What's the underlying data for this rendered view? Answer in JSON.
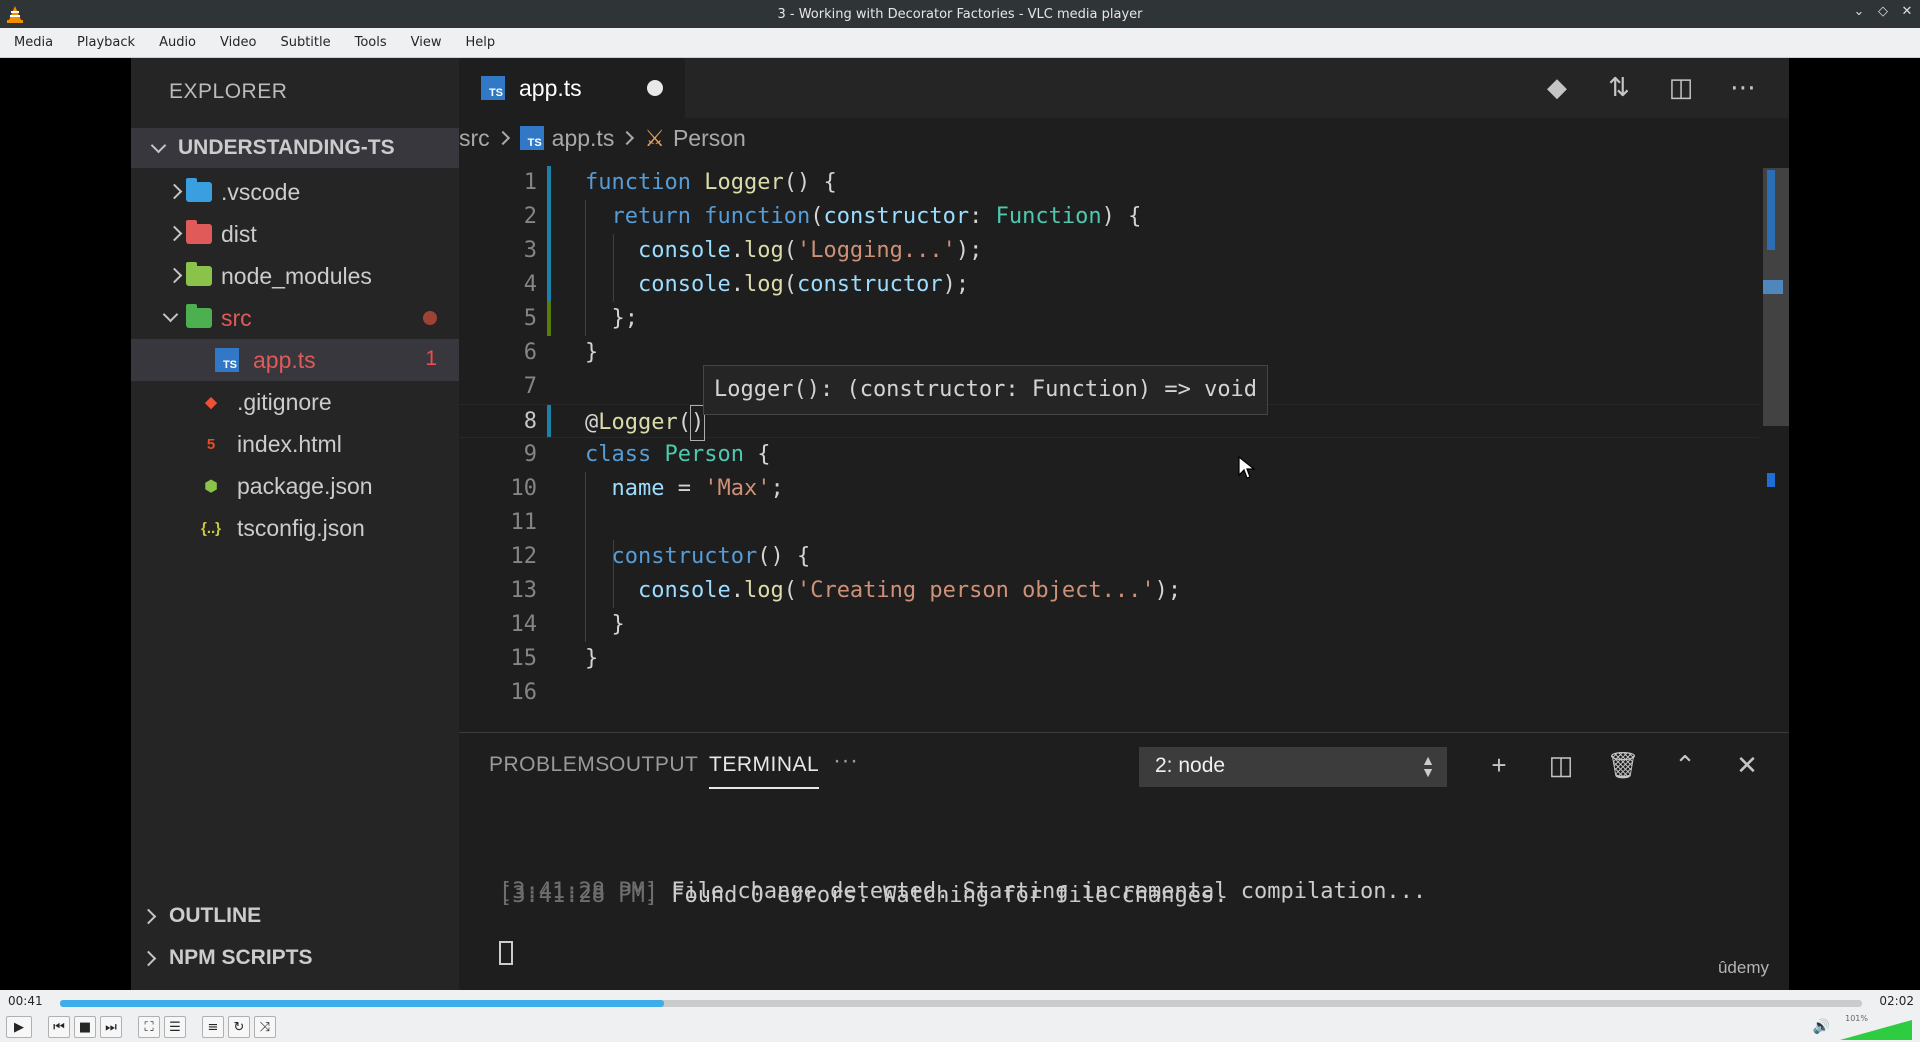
{
  "window": {
    "title": "3 - Working with Decorator Factories - VLC media player"
  },
  "menu": [
    "Media",
    "Playback",
    "Audio",
    "Video",
    "Subtitle",
    "Tools",
    "View",
    "Help"
  ],
  "sidebar": {
    "title": "EXPLORER",
    "project": "UNDERSTANDING-TS",
    "items": [
      {
        "label": ".vscode",
        "icon": "vscode-folder-icon",
        "color": "#3a9fe0"
      },
      {
        "label": "dist",
        "icon": "dist-folder-icon",
        "color": "#e05a5a"
      },
      {
        "label": "node_modules",
        "icon": "node-folder-icon",
        "color": "#8bc34a"
      },
      {
        "label": "src",
        "icon": "src-folder-icon",
        "color": "#4caf50"
      },
      {
        "label": "app.ts",
        "badge": "1"
      },
      {
        "label": ".gitignore"
      },
      {
        "label": "index.html"
      },
      {
        "label": "package.json"
      },
      {
        "label": "tsconfig.json"
      }
    ],
    "outline": "OUTLINE",
    "npm_scripts": "NPM SCRIPTS"
  },
  "editor": {
    "tab": {
      "name": "app.ts",
      "icon_text": "TS"
    },
    "breadcrumb": [
      "src",
      "app.ts",
      "Person"
    ],
    "line_numbers": [
      "1",
      "2",
      "3",
      "4",
      "5",
      "6",
      "7",
      "8",
      "9",
      "10",
      "11",
      "12",
      "13",
      "14",
      "15",
      "16"
    ],
    "hover": "Logger(): (constructor: Function) => void"
  },
  "panel": {
    "tabs": [
      "PROBLEMS",
      "OUTPUT",
      "TERMINAL",
      "···"
    ],
    "terminal_select": "2: node",
    "terminal": [
      {
        "time": "[3:41:28 PM]",
        "text": " File change detected. Starting incremental compilation..."
      },
      {
        "time": "[3:41:28 PM]",
        "text": " Found 0 errors. Watching for file changes."
      }
    ]
  },
  "watermark": "ûdemy",
  "player": {
    "elapsed": "00:41",
    "total": "02:02",
    "progress": 0.335,
    "volume_percent": "101%",
    "accent": "#3daee9"
  }
}
